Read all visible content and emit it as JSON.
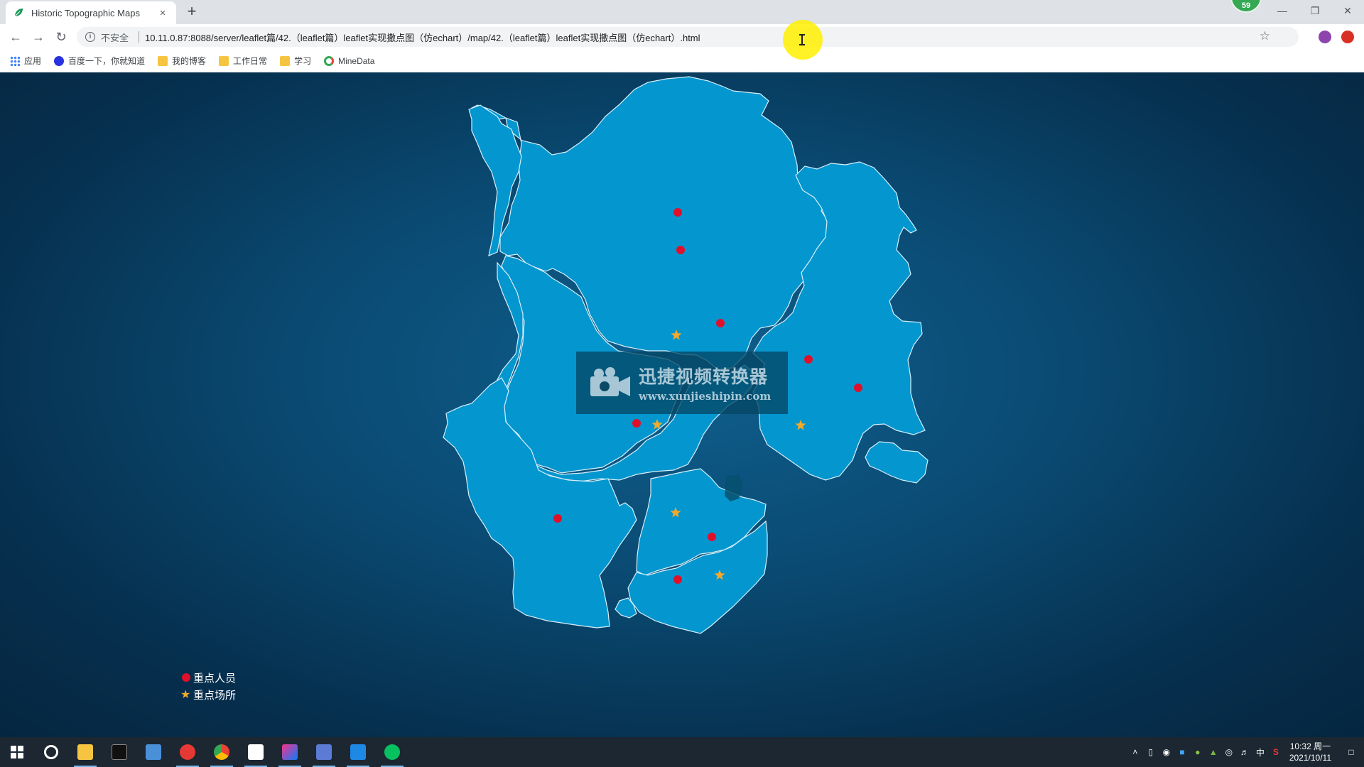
{
  "browser": {
    "tab_title": "Historic Topographic Maps",
    "tab_close": "×",
    "new_tab": "+",
    "profile_count": "59",
    "security_label": "不安全",
    "url": "10.11.0.87:8088/server/leaflet篇/42.（leaflet篇）leaflet实现撒点图（仿echart）/map/42.（leaflet篇）leaflet实现撒点图（仿echart）.html",
    "bookmarks": [
      {
        "label": "应用",
        "icon": "apps-icon"
      },
      {
        "label": "百度一下，你就知道",
        "icon": "baidu-paw-icon"
      },
      {
        "label": "我的博客",
        "icon": "folder-icon"
      },
      {
        "label": "工作日常",
        "icon": "folder-icon"
      },
      {
        "label": "学习",
        "icon": "folder-icon"
      },
      {
        "label": "MineData",
        "icon": "minedata-icon"
      }
    ]
  },
  "map": {
    "accent_region": "#0496cf",
    "border": "#d6f0fb",
    "background": "#0a4a72",
    "person_color": "#e0102a",
    "place_color": "#f3a92b"
  },
  "watermark": {
    "title": "迅捷视频转换器",
    "url": "www.xunjieshipin.com"
  },
  "legend": {
    "person_label": "重点人员",
    "place_label": "重点场所"
  },
  "taskbar": {
    "apps": [
      "start-icon",
      "search-icon",
      "file-explorer-icon",
      "terminal-icon",
      "folder-icon",
      "red-app-icon",
      "chrome-icon",
      "photos-icon",
      "jetbrains-icon",
      "remote-desktop-icon",
      "mail-icon",
      "wechat-icon"
    ],
    "ime": "中",
    "time": "10:32 周一",
    "date": "2021/10/11"
  }
}
